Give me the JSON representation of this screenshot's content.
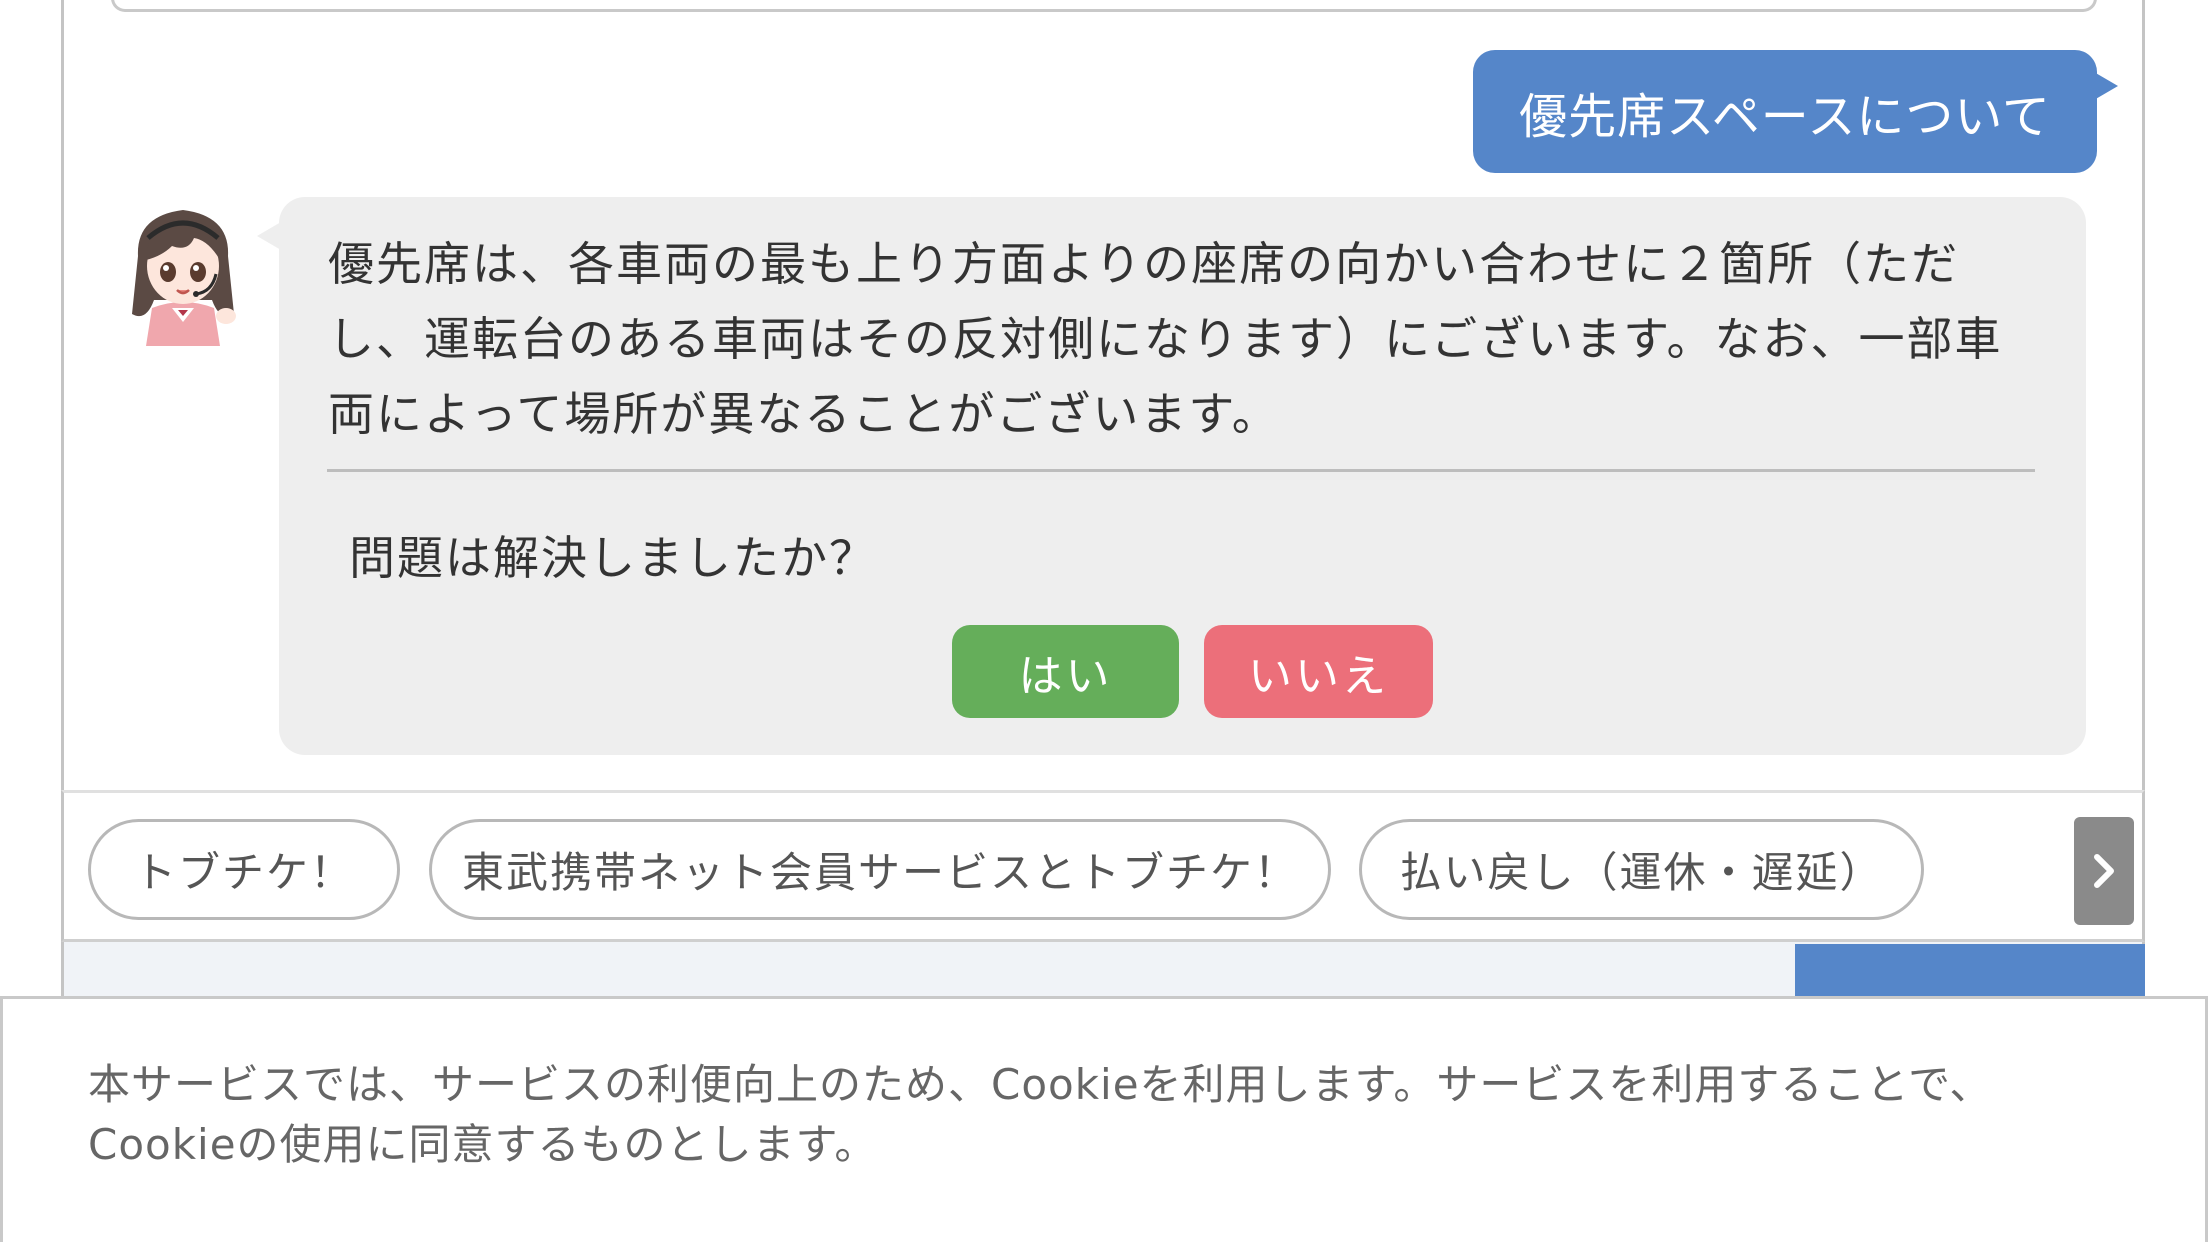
{
  "conversation": {
    "user_message": "優先席スペースについて",
    "bot_message": "優先席は、各車両の最も上り方面よりの座席の向かい合わせに２箇所（ただし、運転台のある車両はその反対側になります）にございます。なお、一部車両によって場所が異なることがございます。",
    "feedback_question": "問題は解決しましたか？",
    "yes_label": "はい",
    "no_label": "いいえ"
  },
  "suggestions": {
    "chips": [
      "トブチケ！",
      "東武携帯ネット会員サービスとトブチケ！",
      "払い戻し（運休・遅延）"
    ],
    "next_icon": "chevron-right-icon"
  },
  "cookie_notice": {
    "text": "本サービスでは、サービスの利便向上のため、Cookieを利用します。サービスを利用することで、Cookieの使用に同意するものとします。"
  },
  "colors": {
    "user_bubble": "#5586c9",
    "bot_bubble": "#eeeeee",
    "yes_button": "#65ae5a",
    "no_button": "#ec6f7a",
    "scroll_button": "#8a8a8a"
  },
  "icons": {
    "avatar": "operator-avatar-icon"
  }
}
